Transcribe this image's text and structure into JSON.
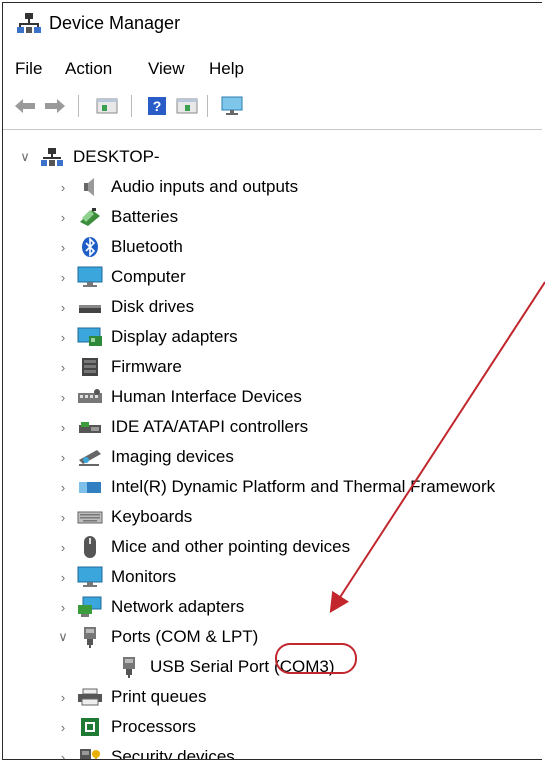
{
  "window": {
    "title": "Device Manager"
  },
  "menu": [
    "File",
    "Action",
    "View",
    "Help"
  ],
  "toolbar": {
    "buttons": [
      "back-arrow-icon",
      "forward-arrow-icon",
      "properties-icon",
      "help-icon",
      "update-driver-icon",
      "monitor-icon"
    ]
  },
  "tree": {
    "root": "DESKTOP-",
    "categories": [
      {
        "label": "Audio inputs and outputs",
        "icon": "speaker-icon"
      },
      {
        "label": "Batteries",
        "icon": "battery-icon"
      },
      {
        "label": "Bluetooth",
        "icon": "bluetooth-icon"
      },
      {
        "label": "Computer",
        "icon": "computer-icon"
      },
      {
        "label": "Disk drives",
        "icon": "disk-drive-icon"
      },
      {
        "label": "Display adapters",
        "icon": "display-adapter-icon"
      },
      {
        "label": "Firmware",
        "icon": "firmware-icon"
      },
      {
        "label": "Human Interface Devices",
        "icon": "hid-icon"
      },
      {
        "label": "IDE ATA/ATAPI controllers",
        "icon": "ide-controller-icon"
      },
      {
        "label": "Imaging devices",
        "icon": "camera-icon"
      },
      {
        "label": "Intel(R) Dynamic Platform and Thermal Framework",
        "icon": "intel-chip-icon"
      },
      {
        "label": "Keyboards",
        "icon": "keyboard-icon"
      },
      {
        "label": "Mice and other pointing devices",
        "icon": "mouse-icon"
      },
      {
        "label": "Monitors",
        "icon": "monitor-icon"
      },
      {
        "label": "Network adapters",
        "icon": "network-adapter-icon"
      },
      {
        "label": "Ports (COM & LPT)",
        "icon": "port-connector-icon"
      },
      {
        "label": "Print queues",
        "icon": "printer-icon"
      },
      {
        "label": "Processors",
        "icon": "processor-icon"
      },
      {
        "label": "Security devices",
        "icon": "security-key-icon"
      }
    ],
    "ports_child": {
      "label": "USB Serial Port",
      "port": "(COM3)"
    }
  },
  "annotation": {
    "color": "#c1272d",
    "highlight": "COM3"
  }
}
